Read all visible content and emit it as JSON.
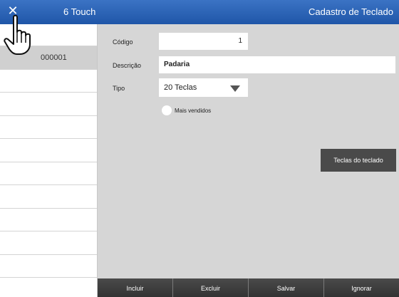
{
  "window": {
    "close_glyph": "✕",
    "app_title": "6 Touch",
    "screen_title": "Cadastro de Teclado"
  },
  "sidebar": {
    "rows": [
      "",
      "000001",
      "",
      "",
      "",
      "",
      "",
      "",
      "",
      "",
      "",
      ""
    ],
    "selected_index": 1
  },
  "form": {
    "codigo": {
      "label": "Código",
      "value": "1"
    },
    "descricao": {
      "label": "Descrição",
      "value": "Padaria"
    },
    "tipo": {
      "label": "Tipo",
      "value": "20 Teclas"
    },
    "mais_vendidos": {
      "label": "Mais vendidos",
      "checked": false
    },
    "teclas_button": "Teclas do teclado"
  },
  "actions": {
    "incluir": "Incluir",
    "excluir": "Excluir",
    "salvar": "Salvar",
    "ignorar": "Ignorar"
  },
  "colors": {
    "titlebar": "#2a62b5",
    "bottom_bar": "#3e3e3e"
  },
  "icons": {
    "close": "close-icon",
    "cursor": "hand-pointer-icon",
    "dropdown": "triangle-down-icon"
  }
}
